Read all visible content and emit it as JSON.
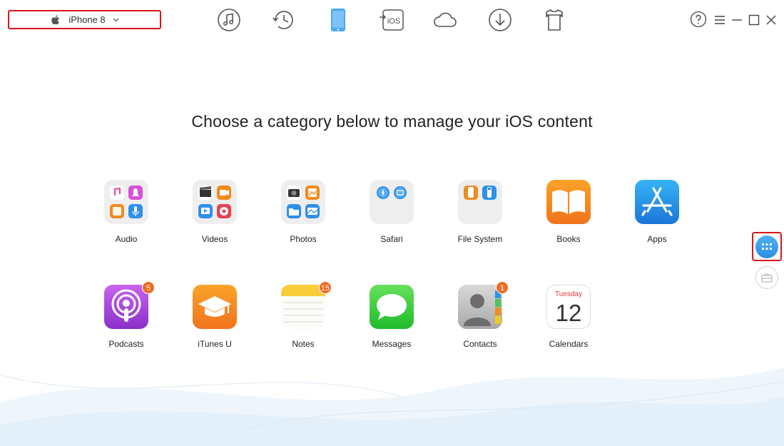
{
  "device": {
    "name": "iPhone 8"
  },
  "toolbar": [
    {
      "icon": "music-note-icon"
    },
    {
      "icon": "history-clock-icon"
    },
    {
      "icon": "iphone-icon"
    },
    {
      "icon": "to-ios-icon",
      "label": "iOS"
    },
    {
      "icon": "cloud-icon"
    },
    {
      "icon": "download-icon"
    },
    {
      "icon": "tshirt-icon"
    }
  ],
  "window_controls": [
    "help-icon",
    "menu-icon",
    "minimize-icon",
    "maximize-icon",
    "close-icon"
  ],
  "headline": "Choose a category below to manage your iOS content",
  "categories": {
    "row1": [
      {
        "label": "Audio"
      },
      {
        "label": "Videos"
      },
      {
        "label": "Photos"
      },
      {
        "label": "Safari"
      },
      {
        "label": "File System"
      },
      {
        "label": "Books"
      },
      {
        "label": "Apps"
      }
    ],
    "row2": [
      {
        "label": "Podcasts",
        "badge": "5"
      },
      {
        "label": "iTunes U"
      },
      {
        "label": "Notes",
        "badge": "15"
      },
      {
        "label": "Messages"
      },
      {
        "label": "Contacts",
        "badge": "1"
      },
      {
        "label": "Calendars",
        "day_name": "Tuesday",
        "day_number": "12"
      }
    ]
  },
  "colors": {
    "accent": "#2b8fe0",
    "highlight": "#d9141b",
    "badge": "#f06a23"
  }
}
